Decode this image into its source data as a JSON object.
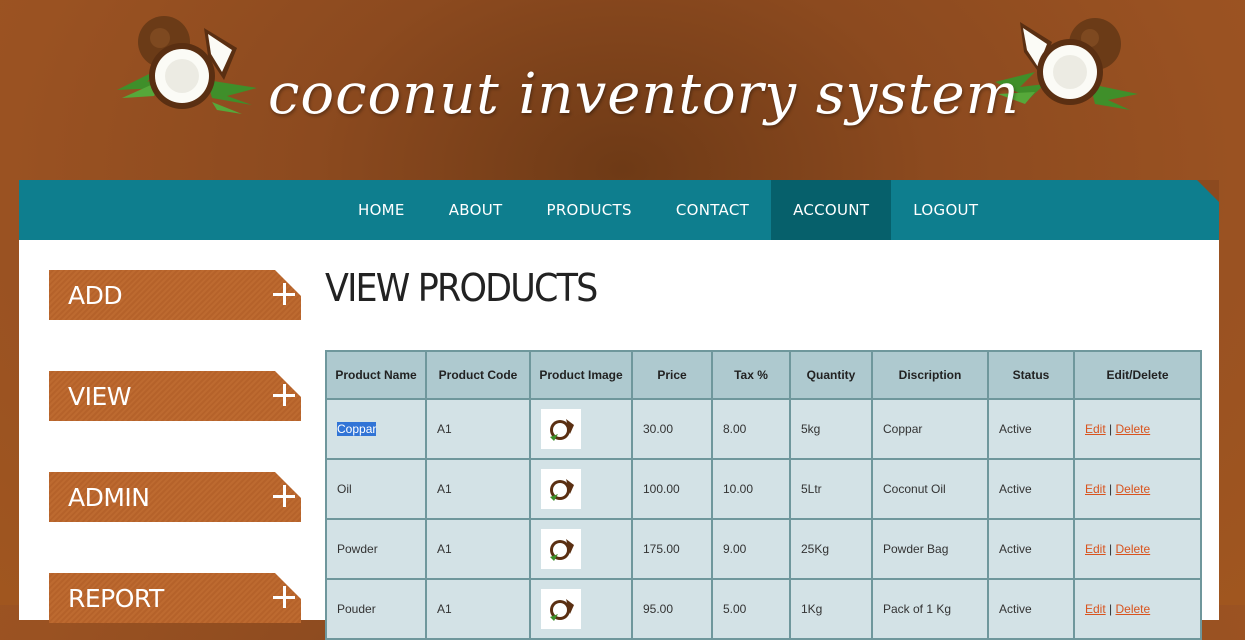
{
  "site": {
    "title": "coconut inventory system"
  },
  "nav": {
    "items": [
      {
        "label": "HOME"
      },
      {
        "label": "ABOUT"
      },
      {
        "label": "PRODUCTS"
      },
      {
        "label": "CONTACT"
      },
      {
        "label": "ACCOUNT",
        "active": true
      },
      {
        "label": "LOGOUT"
      }
    ]
  },
  "sidebar": {
    "items": [
      {
        "label": "ADD"
      },
      {
        "label": "VIEW"
      },
      {
        "label": "ADMIN"
      },
      {
        "label": "REPORT"
      }
    ]
  },
  "page": {
    "title": "VIEW PRODUCTS"
  },
  "table": {
    "headers": [
      "Product Name",
      "Product Code",
      "Product Image",
      "Price",
      "Tax %",
      "Quantity",
      "Discription",
      "Status",
      "Edit/Delete"
    ],
    "rows": [
      {
        "name": "Coppar",
        "code": "A1",
        "image": "coconut-thumbnail",
        "price": "30.00",
        "tax": "8.00",
        "quantity": "5kg",
        "description": "Coppar",
        "status": "Active",
        "edit": "Edit",
        "delete": "Delete"
      },
      {
        "name": "Oil",
        "code": "A1",
        "image": "coconut-thumbnail",
        "price": "100.00",
        "tax": "10.00",
        "quantity": "5Ltr",
        "description": "Coconut Oil",
        "status": "Active",
        "edit": "Edit",
        "delete": "Delete"
      },
      {
        "name": "Powder",
        "code": "A1",
        "image": "coconut-thumbnail",
        "price": "175.00",
        "tax": "9.00",
        "quantity": "25Kg",
        "description": "Powder Bag",
        "status": "Active",
        "edit": "Edit",
        "delete": "Delete"
      },
      {
        "name": "Pouder",
        "code": "A1",
        "image": "coconut-thumbnail",
        "price": "95.00",
        "tax": "5.00",
        "quantity": "1Kg",
        "description": "Pack of 1 Kg",
        "status": "Active",
        "edit": "Edit",
        "delete": "Delete"
      }
    ],
    "separator": "|"
  },
  "colors": {
    "nav": "#0e7e8e",
    "nav_active": "#06606b",
    "sidebar_button": "#b5622a",
    "table_header": "#aec9cf",
    "table_cell": "#d3e2e6",
    "link": "#d8541f",
    "background": "#9a5222"
  }
}
